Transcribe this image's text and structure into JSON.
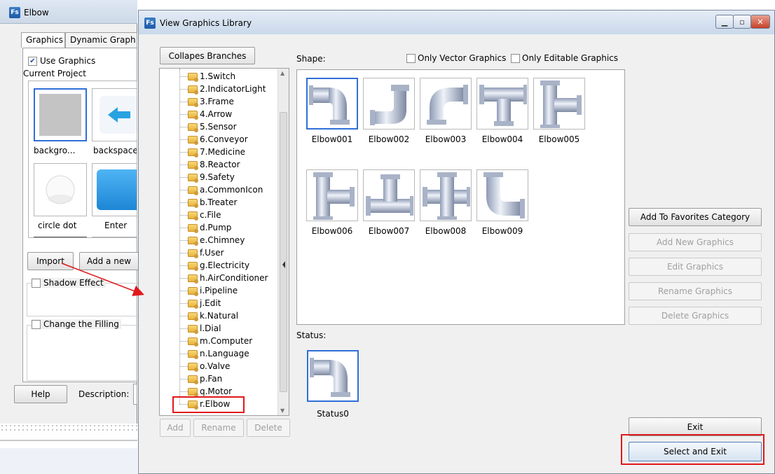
{
  "bg_window": {
    "title": "Elbow",
    "tabs": [
      "Graphics",
      "Dynamic Graph"
    ],
    "use_graphics_label": "Use Graphics",
    "current_project_label": "Current Project",
    "thumb_labels": [
      "backgro...",
      "backspace",
      "circle dot",
      "Enter"
    ],
    "import_label": "Import",
    "add_new_label": "Add a new",
    "shadow_label": "Shadow Effect",
    "change_filling_label": "Change the Filling",
    "help_label": "Help",
    "description_label": "Description:"
  },
  "dialog": {
    "title": "View Graphics Library",
    "collapse_label": "Collapes Branches",
    "shape_label": "Shape:",
    "only_vector_label": "Only Vector Graphics",
    "only_editable_label": "Only Editable Graphics",
    "tree_items": [
      "1.Switch",
      "2.IndicatorLight",
      "3.Frame",
      "4.Arrow",
      "5.Sensor",
      "6.Conveyor",
      "7.Medicine",
      "8.Reactor",
      "9.Safety",
      "a.CommonIcon",
      "b.Treater",
      "c.File",
      "d.Pump",
      "e.Chimney",
      "f.User",
      "g.Electricity",
      "h.AirConditioner",
      "i.Pipeline",
      "j.Edit",
      "k.Natural",
      "l.Dial",
      "m.Computer",
      "n.Language",
      "o.Valve",
      "p.Fan",
      "q.Motor",
      "r.Elbow"
    ],
    "graphics": [
      "Elbow001",
      "Elbow002",
      "Elbow003",
      "Elbow004",
      "Elbow005",
      "Elbow006",
      "Elbow007",
      "Elbow008",
      "Elbow009"
    ],
    "status_label": "Status:",
    "status_items": [
      "Status0"
    ],
    "buttons": {
      "add_favorites": "Add To Favorites Category",
      "add_new": "Add New Graphics",
      "edit": "Edit Graphics",
      "rename": "Rename Graphics",
      "delete": "Delete Graphics",
      "tree_add": "Add",
      "tree_rename": "Rename",
      "tree_delete": "Delete",
      "exit": "Exit",
      "select_exit": "Select and Exit"
    }
  },
  "colors": {
    "highlight": "#e0191b",
    "selection": "#2f6fd8"
  }
}
